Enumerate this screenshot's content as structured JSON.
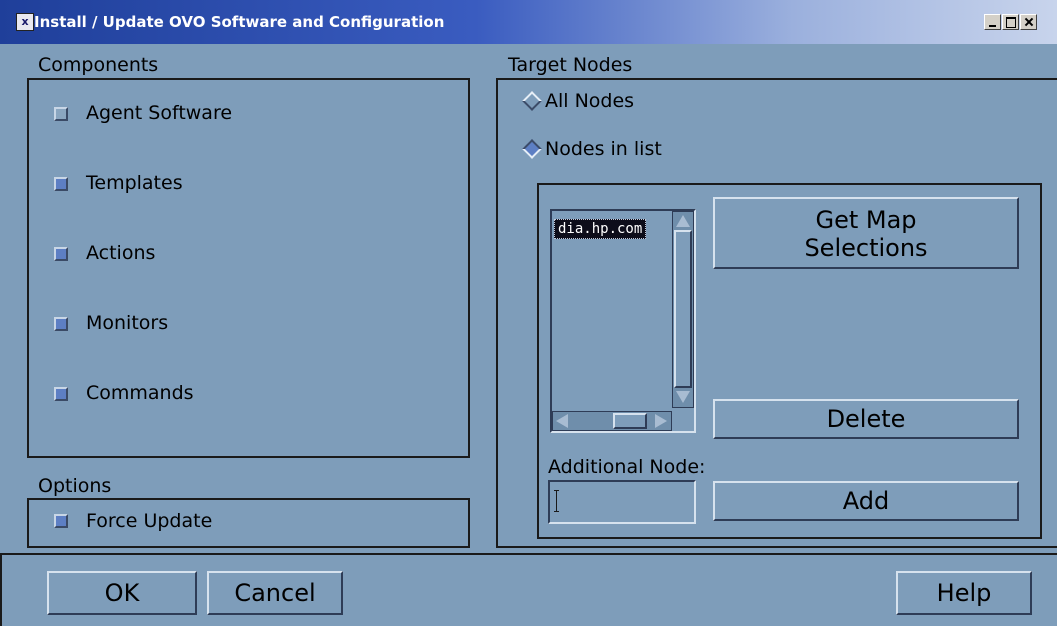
{
  "window": {
    "title": "Install / Update OVO Software and Configuration",
    "icon_label": "x"
  },
  "components": {
    "label": "Components",
    "items": [
      {
        "label": "Agent Software",
        "checked": false
      },
      {
        "label": "Templates",
        "checked": true
      },
      {
        "label": "Actions",
        "checked": true
      },
      {
        "label": "Monitors",
        "checked": true
      },
      {
        "label": "Commands",
        "checked": true
      }
    ]
  },
  "options": {
    "label": "Options",
    "force_update": {
      "label": "Force Update",
      "checked": true
    }
  },
  "target_nodes": {
    "label": "Target Nodes",
    "all_nodes": {
      "label": "All Nodes",
      "selected": false
    },
    "nodes_in_list": {
      "label": "Nodes in list",
      "selected": true
    },
    "node_list": [
      "dia.hp.com"
    ],
    "get_map_selections_line1": "Get Map",
    "get_map_selections_line2": "Selections",
    "delete_label": "Delete",
    "additional_node_label": "Additional Node:",
    "additional_node_value": "",
    "add_label": "Add"
  },
  "footer": {
    "ok_label": "OK",
    "cancel_label": "Cancel",
    "help_label": "Help"
  }
}
